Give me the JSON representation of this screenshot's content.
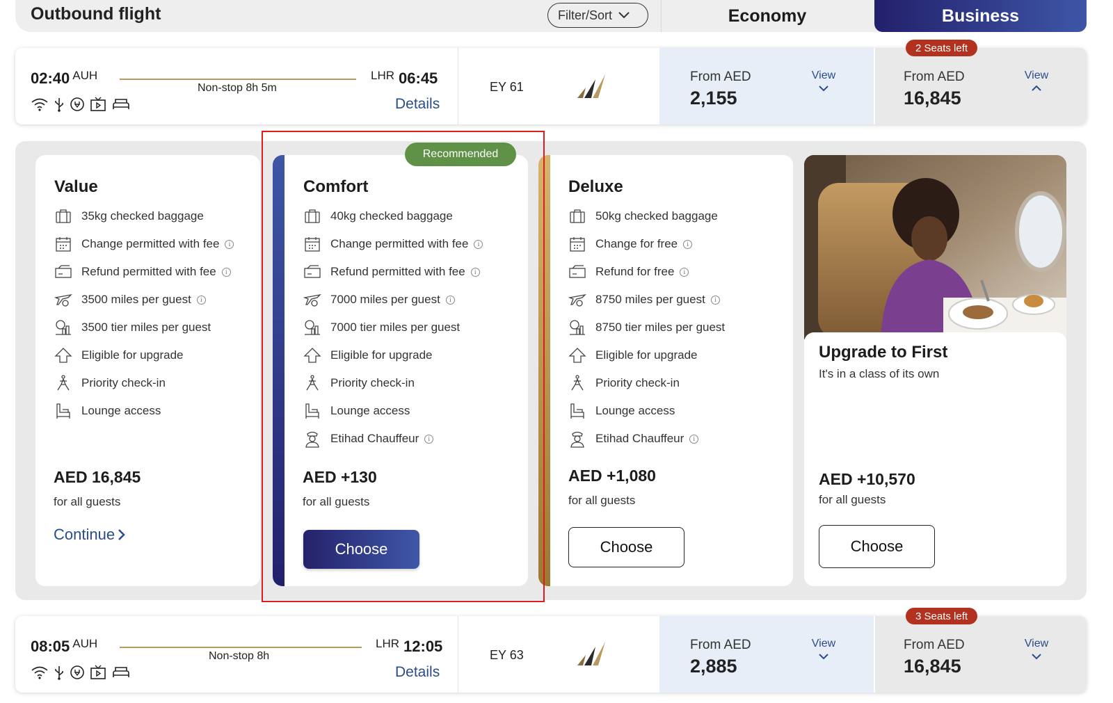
{
  "header": {
    "title": "Outbound flight",
    "filter_label": "Filter/Sort",
    "tab_economy": "Economy",
    "tab_business": "Business"
  },
  "flights": [
    {
      "dep_time": "02:40",
      "dep_code": "AUH",
      "arr_code": "LHR",
      "arr_time": "06:45",
      "route": "Non-stop",
      "duration": "8h 5m",
      "details": "Details",
      "flight_no": "EY 61",
      "economy": {
        "from": "From AED",
        "price": "2,155",
        "view": "View"
      },
      "business": {
        "from": "From AED",
        "price": "16,845",
        "view": "View",
        "seats": "2 Seats left"
      }
    },
    {
      "dep_time": "08:05",
      "dep_code": "AUH",
      "arr_code": "LHR",
      "arr_time": "12:05",
      "route": "Non-stop",
      "duration": "8h",
      "details": "Details",
      "flight_no": "EY 63",
      "economy": {
        "from": "From AED",
        "price": "2,885",
        "view": "View"
      },
      "business": {
        "from": "From AED",
        "price": "16,845",
        "view": "View",
        "seats": "3 Seats left"
      }
    }
  ],
  "fares": [
    {
      "name": "Value",
      "features": [
        "35kg checked baggage",
        "Change permitted with fee",
        "Refund permitted with fee",
        "3500 miles per guest",
        "3500 tier miles per guest",
        "Eligible for upgrade",
        "Priority check-in",
        "Lounge access"
      ],
      "price": "AED 16,845",
      "guests": "for all guests",
      "action": "Continue"
    },
    {
      "name": "Comfort",
      "badge": "Recommended",
      "features": [
        "40kg checked baggage",
        "Change permitted with fee",
        "Refund permitted with fee",
        "7000 miles per guest",
        "7000 tier miles per guest",
        "Eligible for upgrade",
        "Priority check-in",
        "Lounge access",
        "Etihad Chauffeur"
      ],
      "price": "AED +130",
      "guests": "for all guests",
      "action": "Choose"
    },
    {
      "name": "Deluxe",
      "features": [
        "50kg checked baggage",
        "Change for free",
        "Refund for free",
        "8750 miles per guest",
        "8750 tier miles per guest",
        "Eligible for upgrade",
        "Priority check-in",
        "Lounge access",
        "Etihad Chauffeur"
      ],
      "price": "AED +1,080",
      "guests": "for all guests",
      "action": "Choose"
    }
  ],
  "upgrade": {
    "title": "Upgrade to First",
    "subtitle": "It's in a class of its own",
    "price": "AED +10,570",
    "guests": "for all guests",
    "action": "Choose"
  },
  "colors": {
    "accent": "#2a4c8a",
    "business_tab": "#23206b",
    "gold": "#b99a5e",
    "seats_badge": "#b3311f",
    "recommended": "#5f9146",
    "highlight": "#e01b1b"
  }
}
